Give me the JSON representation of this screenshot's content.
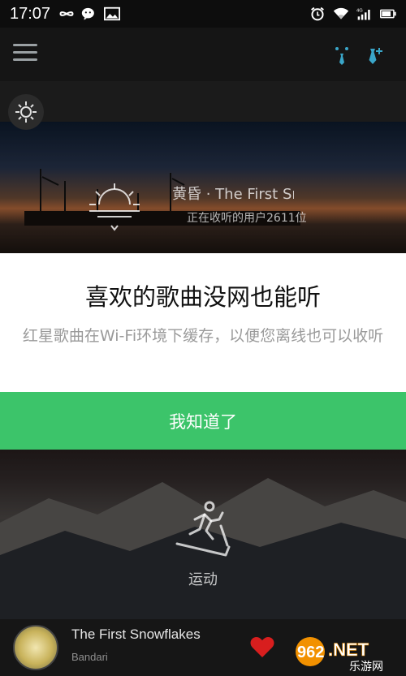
{
  "status_bar": {
    "time": "17:07",
    "icons": [
      "infinity-icon",
      "wechat-icon",
      "image-icon",
      "alarm-icon",
      "wifi-icon",
      "signal-4g-icon",
      "battery-icon"
    ],
    "network_label": "4G"
  },
  "header": {
    "menu_icon": "hamburger-menu-icon",
    "right_icons": [
      "tie-icon",
      "tie-plus-icon"
    ],
    "accent_color": "#3aa6c9"
  },
  "weather_icon": "sun-icon",
  "top_card": {
    "mood_icon": "sunset-icon",
    "title": "黄昏 · The First Sn",
    "listeners": "正在收听的用户2611位"
  },
  "dialog": {
    "title": "喜欢的歌曲没网也能听",
    "body": "红星歌曲在Wi-Fi环境下缓存，以便您离线也可以收听",
    "button_label": "我知道了",
    "button_color": "#3cc46a"
  },
  "bottom_card": {
    "icon": "treadmill-runner-icon",
    "label": "运动"
  },
  "now_playing": {
    "title": "The First Snowflakes",
    "artist": "Bandari",
    "heart_color": "#d81e1e"
  },
  "watermark": {
    "main": "962.NET",
    "sub": "乐游网"
  }
}
